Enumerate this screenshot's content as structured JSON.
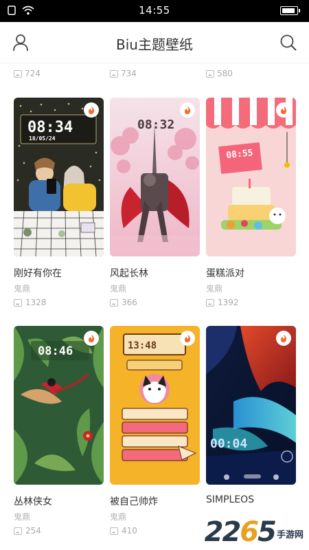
{
  "status_bar": {
    "time": "14:55",
    "battery_level": 0.75
  },
  "header": {
    "title": "Biu主题壁纸",
    "left_icon": "user-icon",
    "right_icon": "search-icon"
  },
  "previous_row_counts": [
    "724",
    "734",
    "580"
  ],
  "cards": [
    {
      "title": "刚好有你在",
      "author": "鬼鼎",
      "count": "1328",
      "clock": "08:34",
      "date": "18/05/24"
    },
    {
      "title": "风起长林",
      "author": "鬼鼎",
      "count": "366",
      "clock": "08:32"
    },
    {
      "title": "蛋糕派对",
      "author": "鬼鼎",
      "count": "1392",
      "clock": "08:55"
    },
    {
      "title": "丛林侠女",
      "author": "鬼鼎",
      "count": "254",
      "clock": "08:46"
    },
    {
      "title": "被自己帅炸",
      "author": "鬼鼎",
      "count": "410",
      "clock": "13:48"
    },
    {
      "title": "SIMPLEOS",
      "author": "",
      "count": "",
      "clock": "00:04"
    }
  ],
  "watermark": {
    "number_a": "22",
    "number_b": "6",
    "number_c": "5",
    "site": "手游网"
  }
}
